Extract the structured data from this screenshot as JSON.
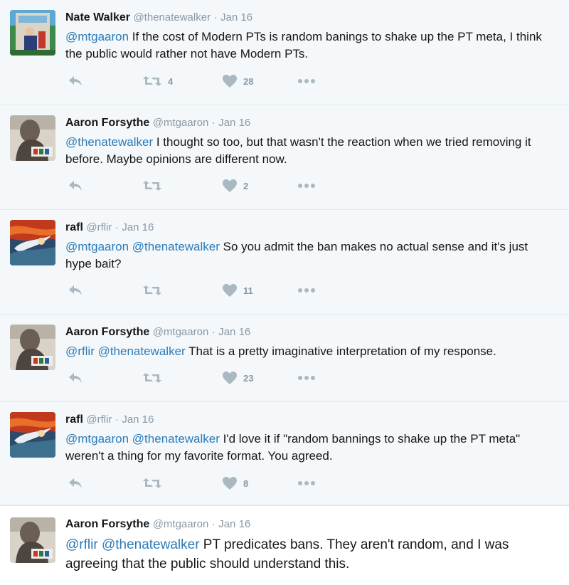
{
  "colors": {
    "mention": "#2b7bb9",
    "meta": "#8899a6",
    "icon": "#aab8c2"
  },
  "icons": {
    "reply": "reply-icon",
    "retweet": "retweet-icon",
    "like": "heart-icon",
    "more": "more-icon"
  },
  "tweets": [
    {
      "name": "Nate Walker",
      "handle": "@thenatewalker",
      "sep": "·",
      "date": "Jan 16",
      "mentions": "@mtgaaron",
      "text": " If the cost of Modern PTs is random banings to shake up the PT meta, I think the public would rather not have Modern PTs.",
      "retweets": "4",
      "likes": "28"
    },
    {
      "name": "Aaron Forsythe",
      "handle": "@mtgaaron",
      "sep": "·",
      "date": "Jan 16",
      "mentions": "@thenatewalker",
      "text": " I thought so too, but that wasn't the reaction when we tried removing it before. Maybe opinions are different now.",
      "retweets": "",
      "likes": "2"
    },
    {
      "name": "rafl",
      "handle": "@rflir",
      "sep": "·",
      "date": "Jan 16",
      "mentions": "@mtgaaron @thenatewalker",
      "text": " So you admit the ban makes no actual sense and it's just hype bait?",
      "retweets": "",
      "likes": "11"
    },
    {
      "name": "Aaron Forsythe",
      "handle": "@mtgaaron",
      "sep": "·",
      "date": "Jan 16",
      "mentions": "@rflir @thenatewalker",
      "text": " That is a pretty imaginative interpretation of my response.",
      "retweets": "",
      "likes": "23"
    },
    {
      "name": "rafl",
      "handle": "@rflir",
      "sep": "·",
      "date": "Jan 16",
      "mentions": "@mtgaaron @thenatewalker",
      "text": " I'd love it if \"random bannings to shake up the PT meta\" weren't a thing for my favorite format. You agreed.",
      "retweets": "",
      "likes": "8"
    },
    {
      "name": "Aaron Forsythe",
      "handle": "@mtgaaron",
      "sep": "·",
      "date": "Jan 16",
      "mentions": "@rflir @thenatewalker",
      "text": " PT predicates bans. They aren't random, and I was agreeing that the public should understand this."
    }
  ]
}
